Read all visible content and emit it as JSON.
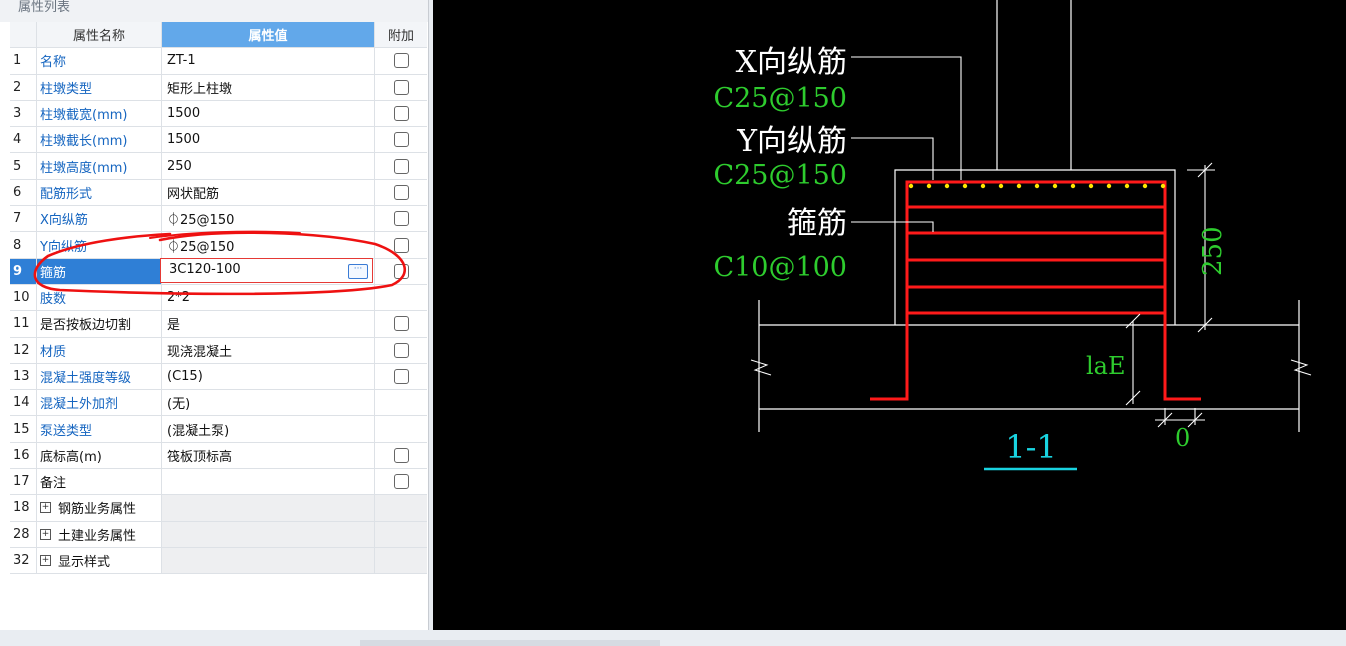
{
  "panel": {
    "title": "属性列表",
    "headers": {
      "name": "属性名称",
      "value": "属性值",
      "attach": "附加"
    },
    "rows": [
      {
        "no": "1",
        "name": "名称",
        "value": "ZT-1",
        "check": true,
        "blue": true
      },
      {
        "no": "2",
        "name": "柱墩类型",
        "value": "矩形上柱墩",
        "check": true,
        "blue": true
      },
      {
        "no": "3",
        "name": "柱墩截宽(mm)",
        "value": "1500",
        "check": true,
        "blue": true
      },
      {
        "no": "4",
        "name": "柱墩截长(mm)",
        "value": "1500",
        "check": true,
        "blue": true
      },
      {
        "no": "5",
        "name": "柱墩高度(mm)",
        "value": "250",
        "check": true,
        "blue": true
      },
      {
        "no": "6",
        "name": "配筋形式",
        "value": "网状配筋",
        "check": true,
        "blue": true
      },
      {
        "no": "7",
        "name": "X向纵筋",
        "value": "⏀25@150",
        "check": true,
        "blue": true
      },
      {
        "no": "8",
        "name": "Y向纵筋",
        "value": "⏀25@150",
        "check": true,
        "blue": true
      },
      {
        "no": "9",
        "name": "箍筋",
        "value": "3C120-100",
        "check": true,
        "blue": true,
        "selected": true
      },
      {
        "no": "10",
        "name": "肢数",
        "value": "2*2",
        "check": false,
        "blue": true
      },
      {
        "no": "11",
        "name": "是否按板边切割",
        "value": "是",
        "check": true,
        "blue": false
      },
      {
        "no": "12",
        "name": "材质",
        "value": "现浇混凝土",
        "check": true,
        "blue": true
      },
      {
        "no": "13",
        "name": "混凝土强度等级",
        "value": "(C15)",
        "check": true,
        "blue": true
      },
      {
        "no": "14",
        "name": "混凝土外加剂",
        "value": "(无)",
        "check": false,
        "blue": true
      },
      {
        "no": "15",
        "name": "泵送类型",
        "value": "(混凝土泵)",
        "check": false,
        "blue": true
      },
      {
        "no": "16",
        "name": "底标高(m)",
        "value": "筏板顶标高",
        "check": true,
        "blue": false
      },
      {
        "no": "17",
        "name": "备注",
        "value": "",
        "check": true,
        "blue": false
      },
      {
        "no": "18",
        "name": "钢筋业务属性",
        "value": "",
        "check": false,
        "blue": false,
        "group": true
      },
      {
        "no": "28",
        "name": "土建业务属性",
        "value": "",
        "check": false,
        "blue": false,
        "group": true
      },
      {
        "no": "32",
        "name": "显示样式",
        "value": "",
        "check": false,
        "blue": false,
        "group": true
      }
    ],
    "edit_value": "3C120-100",
    "edit_button": "···"
  },
  "drawing": {
    "x_rebar_label": "X向纵筋",
    "x_rebar_spec": "C25@150",
    "y_rebar_label": "Y向纵筋",
    "y_rebar_spec": "C25@150",
    "stirrup_label": "箍筋",
    "stirrup_spec": "C10@100",
    "dim_height": "250",
    "dim_lae": "laE",
    "dim_zero": "0",
    "section_label": "1-1",
    "colors": {
      "rebar": "#ff1a1a",
      "label_green": "#2ecc2e",
      "section_cyan": "#19d3e0",
      "dots": "#ffe600"
    }
  }
}
